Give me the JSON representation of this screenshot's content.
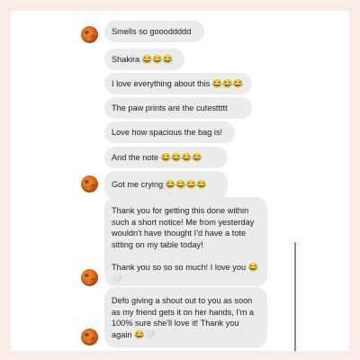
{
  "messages": [
    {
      "text": "Smells so goooddddd"
    },
    {
      "text": "Shakira 😂😂😂"
    },
    {
      "text": "I love everything about this 😂😂😂"
    },
    {
      "text": "The paw prints are the cutesttttt"
    },
    {
      "text": "Love how spacious the bag is!"
    },
    {
      "text": "And the note 😂😂😂😂"
    },
    {
      "text": "Got me crying 😂😂😂😂"
    },
    {
      "paragraphs": [
        "Thank you for getting this done within such a short notice! Me from yesterday wouldn't have thought I'd have a tote sitting on my table today!",
        "Thank you so so so much! I love you 😂🤍"
      ]
    },
    {
      "paragraphs": [
        "Defo giving a shout out to you as soon as my friend gets it on her hands, I'm a 100% sure she'll love it! Thank you again 😂🤍"
      ]
    }
  ],
  "colors": {
    "page_background": "#f8ebe6",
    "bubble_background": "#ebebeb",
    "text": "#1c1c1c",
    "avatar": "#dd6a1c"
  },
  "icons": {
    "avatar": "contact-avatar-icon"
  }
}
